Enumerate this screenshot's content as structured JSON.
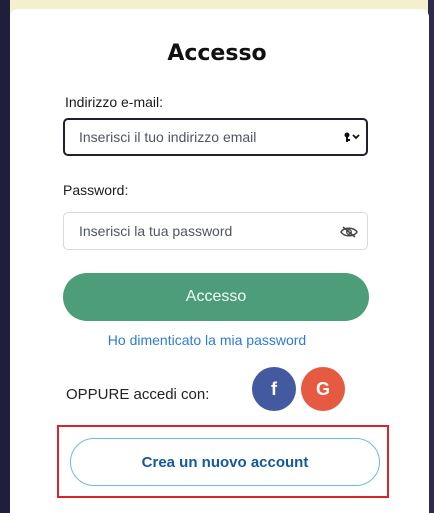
{
  "window": {
    "title": "Accesso"
  },
  "form": {
    "email_label": "Indirizzo e-mail:",
    "email_placeholder": "Inserisci il tuo indirizzo email",
    "email_value": "",
    "password_label": "Password:",
    "password_placeholder": "Inserisci la tua password",
    "password_value": "",
    "login_button_label": "Accesso",
    "forgot_link_label": "Ho dimenticato la mia password"
  },
  "social": {
    "prompt": "OPPURE accedi con:",
    "facebook_label": "f",
    "google_label": "G"
  },
  "signup": {
    "button_label": "Crea un nuovo account"
  },
  "colors": {
    "background": "#f6f1cf",
    "primary": "#4c9d78",
    "link": "#2c7bd6",
    "facebook": "#445aa0",
    "google": "#e55a41",
    "highlight": "#d8242b",
    "secondary_text": "#15589d",
    "secondary_border": "#6bb9ea"
  },
  "icons": {
    "email_field_icon": "key-dropdown-icon",
    "password_field_icon": "eye-slash-icon",
    "facebook_icon": "facebook-icon",
    "google_icon": "google-icon"
  }
}
